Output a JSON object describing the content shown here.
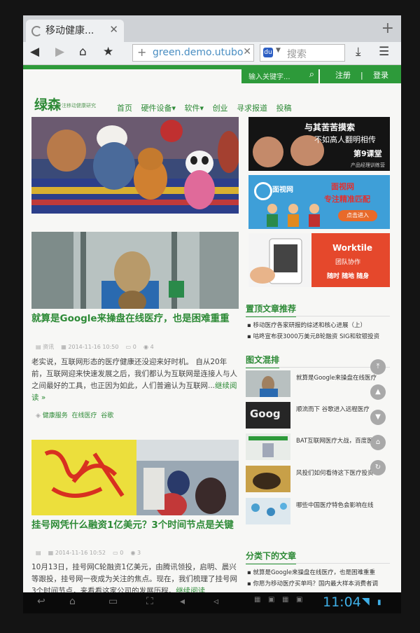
{
  "browser": {
    "tab_title": "移动健康...",
    "url": "green.demo.utubo",
    "search_placeholder": "搜索"
  },
  "site": {
    "search_placeholder": "输入关键字...",
    "register": "注册",
    "login": "登录",
    "divider": "|",
    "logo": "绿森",
    "slogan": "专注移动健康研究",
    "nav": [
      "首页",
      "硬件设备",
      "软件",
      "创业",
      "寻求报道",
      "投稿"
    ]
  },
  "articles": [
    {
      "title": "就算是Google来操盘在线医疗，也是困难重重",
      "category": "资讯",
      "date": "2014-11-16 10:50",
      "comments": "0",
      "views": "4",
      "excerpt": "老实说，互联网形态的医疗健康还没迎来好时机。 自从20年前，互联网迎来快速发展之后，我们都认为互联网是连接人与人之间最好的工具，也正因为如此，人们普遍认为互联网...",
      "more": "继续阅读 »",
      "tags": [
        "健康服务",
        "在线医疗",
        "谷歌"
      ]
    },
    {
      "title": "挂号网凭什么融资1亿美元？3个时间节点是关键",
      "category": "",
      "date": "2014-11-16 10:52",
      "comments": "0",
      "views": "3",
      "excerpt": "10月13日，挂号网C轮融资1亿美元，由腾讯领投，启明、晨兴等跟投，挂号网一夜成为关注的焦点。现在，我们梳理了挂号网3个时间节点，来看看这家公司的发展历程。",
      "more": "继续阅读"
    }
  ],
  "ads": {
    "ad1_line1": "与其苦苦摸索",
    "ad1_line2": "不如高人翻明相传",
    "ad1_brand": "第9课堂",
    "ad1_sub": "产品经理训练营",
    "ad2_brand": "面视网",
    "ad2_line1": "面视网",
    "ad2_line2": "专注精准匹配",
    "ad2_cta": "点击进入",
    "ad3_brand": "Worktile",
    "ad3_line1": "团队协作",
    "ad3_line2": "随时 随地 随身"
  },
  "sidebar": {
    "featured_heading": "置顶文章推荐",
    "featured": [
      "移动医疗各家研报的综述和核心进展（上）",
      "咕咚宣布获3000万美元B轮融资 SIG和软银投资"
    ],
    "gallery_heading": "图文混排",
    "gallery": [
      "就算是Google来操盘在线医疗",
      "顺流而下 谷歌进入远程医疗",
      "BAT互联网医疗大战，百度医",
      "风投们如何看待这下医疗投资",
      "哪些中国医疗特色会影响在线"
    ],
    "category_heading": "分类下的文章",
    "category_posts": [
      "就算是Google来操盘在线医疗，也是困难重重",
      "你愿为移动医疗买单吗？国内最大样本消费者调"
    ]
  },
  "float_buttons": [
    "⤒",
    "▲",
    "▼",
    "⌂",
    "↻"
  ],
  "system": {
    "time": "11:04"
  },
  "colors": {
    "brand_green": "#2d9a3a",
    "link_green": "#2d8a36",
    "clock_blue": "#3fb0e8"
  }
}
